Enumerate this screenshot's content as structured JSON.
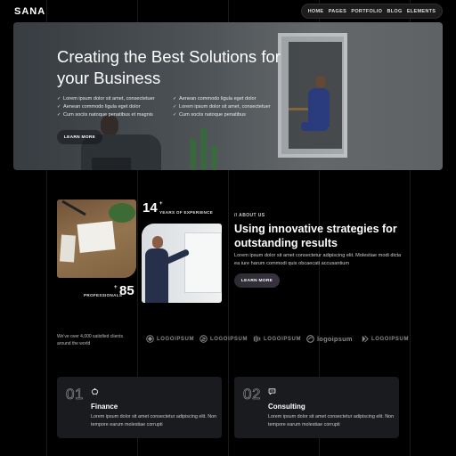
{
  "header": {
    "brand": "SANA",
    "nav": [
      "HOME",
      "PAGES",
      "PORTFOLIO",
      "BLOG",
      "ELEMENTS"
    ]
  },
  "hero": {
    "title": "Creating the Best Solutions for your Business",
    "list_left": [
      "Lorem ipsum dolor sit amet, consectetuer",
      "Aenean commodo ligula eget dolor",
      "Cum sociis natoque penatibus et magnis"
    ],
    "list_right": [
      "Aenean commodo ligula eget dolor",
      "Lorem ipsum dolor sit amet, consectetuer",
      "Cum sociis natoque penatibus"
    ],
    "button": "LEARN MORE"
  },
  "about": {
    "years_value": "14",
    "years_plus": "+",
    "years_label": "YEARS OF EXPERIENCE",
    "pros_value": "85",
    "pros_plus": "+",
    "pros_label": "PROFESSIONALS",
    "tag": "// ABOUT US",
    "title": "Using innovative strategies for outstanding results",
    "text": "Lorem ipsum dolor sit amet consectetur adipiscing elit. Molestiae modi dicta ea iure harum commodi quis obcaecati accusantium",
    "button": "LEARN MORE"
  },
  "clients": {
    "text": "We've over 4,000 satisfied clients around the world",
    "logos": [
      "LOGOIPSUM",
      "LOGOIPSUM",
      "LOGOIPSUM",
      "logoipsum",
      "LOGOIPSUM"
    ]
  },
  "services": [
    {
      "num": "01",
      "title": "Finance",
      "text": "Lorem ipsum dolor sit amet consectetur adipiscing elit. Non tempore earum molestiae corrupti",
      "icon": "piggy-bank-icon"
    },
    {
      "num": "02",
      "title": "Consulting",
      "text": "Lorem ipsum dolor sit amet consectetur adipiscing elit. Non tempore earum molestiae corrupti",
      "icon": "chat-bubble-icon"
    }
  ]
}
